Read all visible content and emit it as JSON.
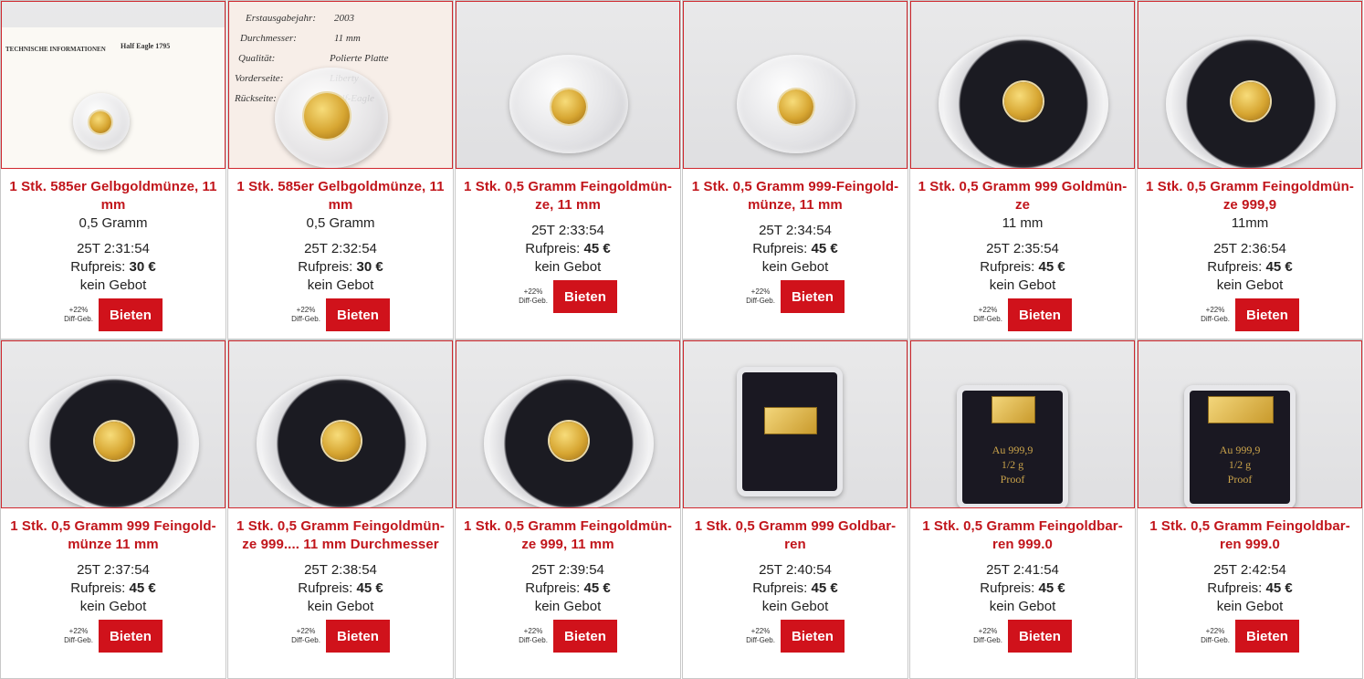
{
  "bid_label": "Bieten",
  "fee_line1": "+22%",
  "fee_line2": "Diff-Geb.",
  "products": [
    {
      "title": "1 Stk. 585er Gelbgoldmünze, 11 mm",
      "sub": "0,5 Gramm",
      "time": "25T 2:31:54",
      "price_label": "Rufpreis:",
      "price": "30 €",
      "status": "kein Gebot",
      "photo": "doc-coin"
    },
    {
      "title": "1 Stk. 585er Gelbgoldmünze, 11 mm",
      "sub": "0,5 Gramm",
      "time": "25T 2:32:54",
      "price_label": "Rufpreis:",
      "price": "30 €",
      "status": "kein Gebot",
      "photo": "doc-coin-large"
    },
    {
      "title": "1 Stk. 0,5 Gramm Feingoldmün-ze, 11 mm",
      "sub": "",
      "time": "25T 2:33:54",
      "price_label": "Rufpreis:",
      "price": "45 €",
      "status": "kein Gebot",
      "photo": "clear-capsule"
    },
    {
      "title": "1 Stk. 0,5 Gramm 999-Feingold-münze, 11 mm",
      "sub": "",
      "time": "25T 2:34:54",
      "price_label": "Rufpreis:",
      "price": "45 €",
      "status": "kein Gebot",
      "photo": "clear-capsule"
    },
    {
      "title": "1 Stk. 0,5 Gramm 999 Goldmün-ze",
      "sub": "11 mm",
      "time": "25T 2:35:54",
      "price_label": "Rufpreis:",
      "price": "45 €",
      "status": "kein Gebot",
      "photo": "dark-capsule"
    },
    {
      "title": "1 Stk. 0,5 Gramm Feingoldmün-ze 999,9",
      "sub": "11mm",
      "time": "25T 2:36:54",
      "price_label": "Rufpreis:",
      "price": "45 €",
      "status": "kein Gebot",
      "photo": "dark-capsule"
    },
    {
      "title": "1 Stk. 0,5 Gramm 999 Feingold-münze 11 mm",
      "sub": "",
      "time": "25T 2:37:54",
      "price_label": "Rufpreis:",
      "price": "45 €",
      "status": "kein Gebot",
      "photo": "dark-capsule"
    },
    {
      "title": "1 Stk. 0,5 Gramm Feingoldmün-ze 999.... 11 mm Durchmesser",
      "sub": "",
      "time": "25T 2:38:54",
      "price_label": "Rufpreis:",
      "price": "45 €",
      "status": "kein Gebot",
      "photo": "dark-capsule"
    },
    {
      "title": "1 Stk. 0,5 Gramm Feingoldmün-ze 999, 11 mm",
      "sub": "",
      "time": "25T 2:39:54",
      "price_label": "Rufpreis:",
      "price": "45 €",
      "status": "kein Gebot",
      "photo": "dark-capsule"
    },
    {
      "title": "1 Stk. 0,5 Gramm 999 Goldbar-ren",
      "sub": "",
      "time": "25T 2:40:54",
      "price_label": "Rufpreis:",
      "price": "45 €",
      "status": "kein Gebot",
      "photo": "bar-case-flat"
    },
    {
      "title": "1 Stk. 0,5 Gramm Feingoldbar-ren 999.0",
      "sub": "",
      "time": "25T 2:41:54",
      "price_label": "Rufpreis:",
      "price": "45 €",
      "status": "kein Gebot",
      "photo": "bar-case-tall"
    },
    {
      "title": "1 Stk. 0,5 Gramm Feingoldbar-ren 999.0",
      "sub": "",
      "time": "25T 2:42:54",
      "price_label": "Rufpreis:",
      "price": "45 €",
      "status": "kein Gebot",
      "photo": "bar-case-wide"
    }
  ],
  "doc_text": {
    "heading": "TECHNISCHE INFORMATIONEN",
    "side_heading": "Half Eagle 1795",
    "rows": [
      "Erstausgabejahr:",
      "2003",
      "Durchmesser:",
      "11 mm",
      "Qualität:",
      "Polierte Platte",
      "Vorderseite:",
      "Liberty",
      "Rückseite:",
      "Half-Eagle"
    ]
  },
  "bar_text": {
    "purity": "Au 999,9",
    "weight": "1/2 g",
    "quality": "Proof"
  }
}
